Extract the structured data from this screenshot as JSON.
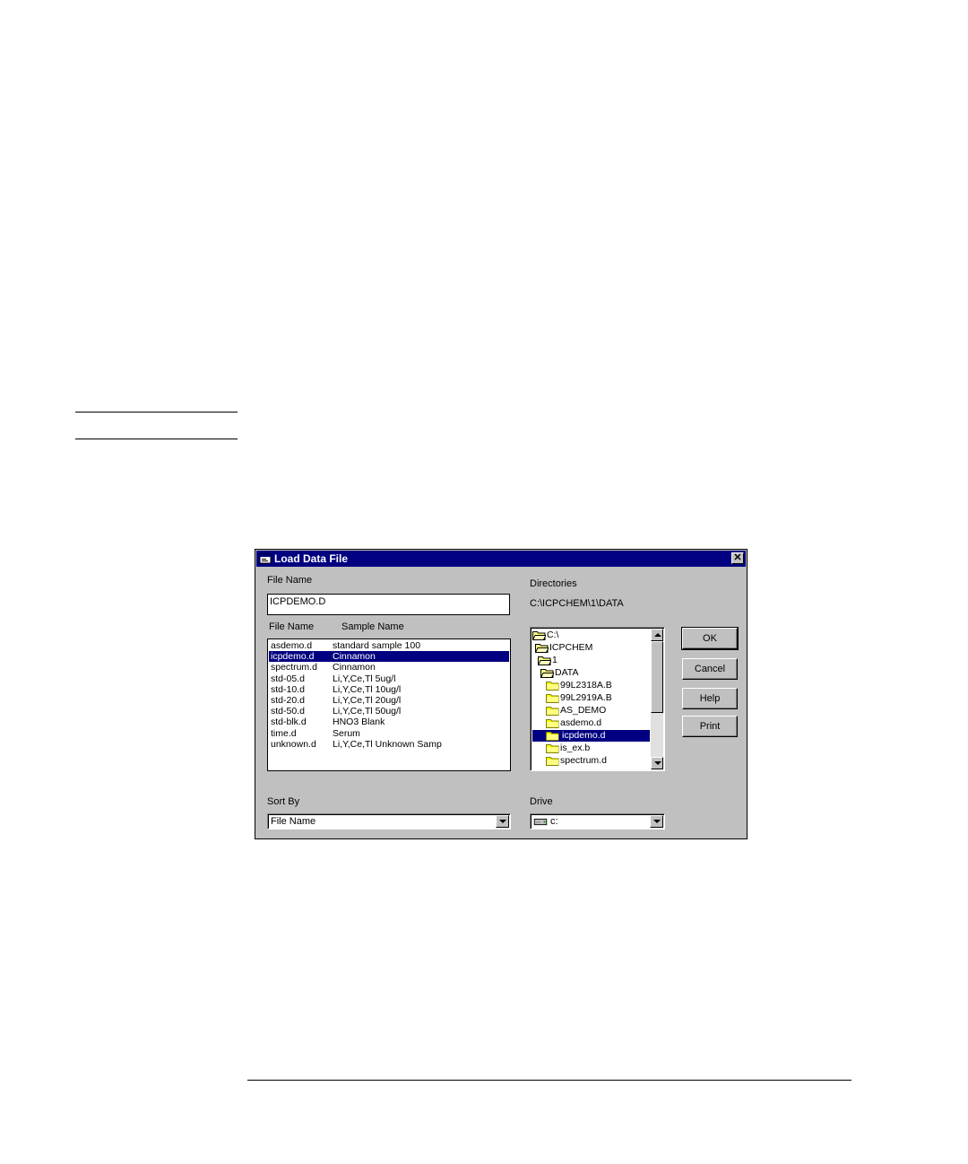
{
  "dialog": {
    "title": "Load Data File",
    "file_name_label": "File Name",
    "file_name_value": "ICPDEMO.D",
    "columns": {
      "file": "File Name",
      "sample": "Sample Name"
    },
    "files": [
      {
        "file": "asdemo.d",
        "sample": "standard sample 100",
        "selected": false
      },
      {
        "file": "icpdemo.d",
        "sample": "Cinnamon",
        "selected": true
      },
      {
        "file": "spectrum.d",
        "sample": "Cinnamon",
        "selected": false
      },
      {
        "file": "std-05.d",
        "sample": "Li,Y,Ce,Tl 5ug/l",
        "selected": false
      },
      {
        "file": "std-10.d",
        "sample": "Li,Y,Ce,Tl 10ug/l",
        "selected": false
      },
      {
        "file": "std-20.d",
        "sample": "Li,Y,Ce,Tl 20ug/l",
        "selected": false
      },
      {
        "file": "std-50.d",
        "sample": "Li,Y,Ce,Tl 50ug/l",
        "selected": false
      },
      {
        "file": "std-blk.d",
        "sample": "HNO3 Blank",
        "selected": false
      },
      {
        "file": "time.d",
        "sample": "Serum",
        "selected": false
      },
      {
        "file": "unknown.d",
        "sample": "Li,Y,Ce,Tl Unknown Samp",
        "selected": false
      }
    ],
    "directories_label": "Directories",
    "current_path": "C:\\ICPCHEM\\1\\DATA",
    "directories": [
      {
        "name": "C:\\",
        "level": 0,
        "open": true,
        "selected": false
      },
      {
        "name": "ICPCHEM",
        "level": 1,
        "open": true,
        "selected": false
      },
      {
        "name": "1",
        "level": 2,
        "open": true,
        "selected": false
      },
      {
        "name": "DATA",
        "level": 3,
        "open": true,
        "selected": false
      },
      {
        "name": "99L2318A.B",
        "level": 4,
        "open": false,
        "selected": false
      },
      {
        "name": "99L2919A.B",
        "level": 4,
        "open": false,
        "selected": false
      },
      {
        "name": "AS_DEMO",
        "level": 4,
        "open": false,
        "selected": false
      },
      {
        "name": "asdemo.d",
        "level": 4,
        "open": false,
        "selected": false
      },
      {
        "name": "icpdemo.d",
        "level": 4,
        "open": false,
        "selected": true
      },
      {
        "name": "is_ex.b",
        "level": 4,
        "open": false,
        "selected": false
      },
      {
        "name": "spectrum.d",
        "level": 4,
        "open": false,
        "selected": false
      }
    ],
    "buttons": {
      "ok": "OK",
      "cancel": "Cancel",
      "help": "Help",
      "print": "Print"
    },
    "sort_by_label": "Sort By",
    "sort_by_value": "File Name",
    "drive_label": "Drive",
    "drive_value": "c:"
  },
  "colors": {
    "face": "#c0c0c0",
    "titlebar": "#000080",
    "selection": "#000080"
  },
  "icons": [
    "window-icon",
    "close-icon",
    "folder-icon",
    "drive-icon",
    "scroll-up-icon",
    "scroll-down-icon",
    "dropdown-arrow-icon"
  ]
}
